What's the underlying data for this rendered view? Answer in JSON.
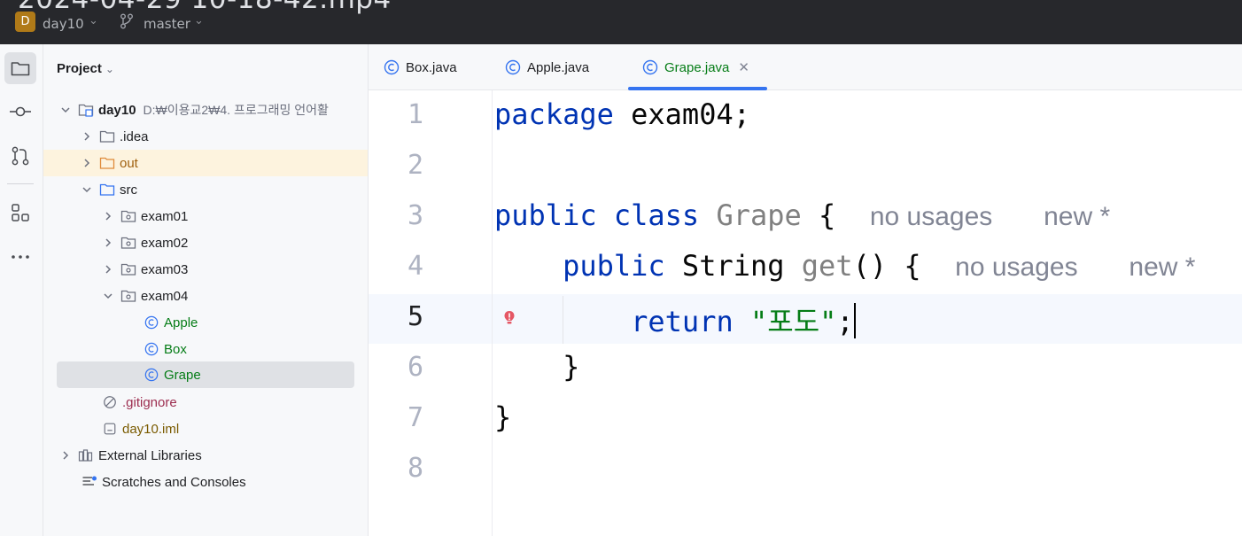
{
  "titlebar": {
    "video_title": "2024-04-29 10-18-42.mp4",
    "project_badge": "D",
    "project_name": "day10",
    "branch": "master"
  },
  "toolstrip": {
    "icons": [
      "folder-icon",
      "commit-icon",
      "pull-requests-icon",
      "structure-icon",
      "more-icon"
    ]
  },
  "project_panel": {
    "header": "Project",
    "tree": [
      {
        "label": "day10",
        "path": "D:₩이용교2₩4. 프로그래밍 언어활"
      },
      {
        "label": ".idea"
      },
      {
        "label": "out"
      },
      {
        "label": "src"
      },
      {
        "label": "exam01"
      },
      {
        "label": "exam02"
      },
      {
        "label": "exam03"
      },
      {
        "label": "exam04"
      },
      {
        "label": "Apple"
      },
      {
        "label": "Box"
      },
      {
        "label": "Grape"
      },
      {
        "label": ".gitignore"
      },
      {
        "label": "day10.iml"
      },
      {
        "label": "External Libraries"
      },
      {
        "label": "Scratches and Consoles"
      }
    ]
  },
  "tabs": [
    {
      "label": "Box.java",
      "active": false
    },
    {
      "label": "Apple.java",
      "active": false
    },
    {
      "label": "Grape.java",
      "active": true
    }
  ],
  "editor": {
    "line_numbers": [
      "1",
      "2",
      "3",
      "4",
      "5",
      "6",
      "7",
      "8"
    ],
    "current_line": "5",
    "lines": {
      "l1_kw": "package",
      "l1_rest": " exam04;",
      "l3_kw1": "public",
      "l3_kw2": "class",
      "l3_name": "Grape",
      "l3_brace": " {",
      "l3_hint1": "no usages",
      "l3_hint2": "new *",
      "l4_kw": "public",
      "l4_type": " String ",
      "l4_method": "get",
      "l4_rest": "() {",
      "l4_hint1": "no usages",
      "l4_hint2": "new *",
      "l5_kw": "return",
      "l5_str": "\"포도\"",
      "l5_semi": ";",
      "l6": "}",
      "l7": "}"
    }
  },
  "colors": {
    "keyword": "#0033b3",
    "string": "#067d17",
    "accent": "#3574f0",
    "titlebar_bg": "#27282c"
  }
}
